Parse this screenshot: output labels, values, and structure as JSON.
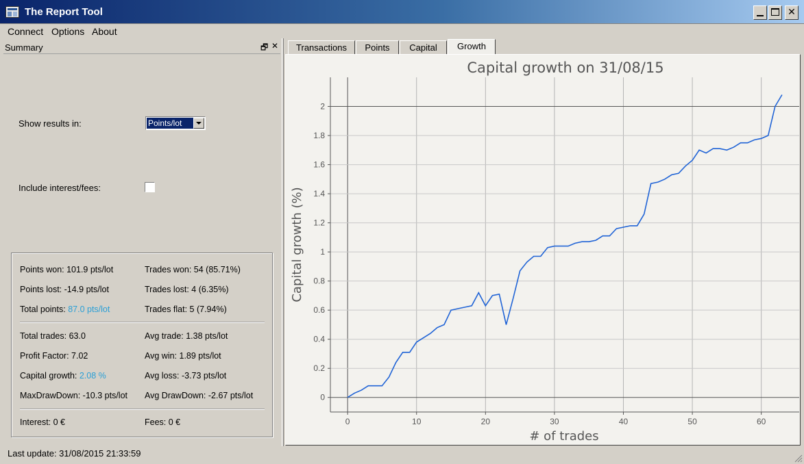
{
  "window": {
    "title": "The Report Tool"
  },
  "menu": [
    "Connect",
    "Options",
    "About"
  ],
  "summary": {
    "title": "Summary",
    "show_results_label": "Show results in:",
    "show_results_value": "Points/lot",
    "include_interest_label": "Include interest/fees:",
    "include_interest_checked": false,
    "stats": {
      "points_won": "Points won: 101.9 pts/lot",
      "trades_won": "Trades won: 54 (85.71%)",
      "points_lost": "Points lost: -14.9 pts/lot",
      "trades_lost": "Trades lost: 4 (6.35%)",
      "total_points_label": "Total points:",
      "total_points_value": "87.0 pts/lot",
      "trades_flat": "Trades flat: 5 (7.94%)",
      "total_trades": "Total trades: 63.0",
      "avg_trade": "Avg trade: 1.38 pts/lot",
      "profit_factor": "Profit Factor: 7.02",
      "avg_win": "Avg win: 1.89 pts/lot",
      "capital_growth_label": "Capital growth:",
      "capital_growth_value": "2.08 %",
      "avg_loss": "Avg loss: -3.73 pts/lot",
      "max_drawdown": "MaxDrawDown: -10.3 pts/lot",
      "avg_drawdown": "Avg DrawDown: -2.67 pts/lot",
      "interest": "Interest: 0 €",
      "fees": "Fees: 0 €"
    }
  },
  "status_bar": "Last update: 31/08/2015 21:33:59",
  "tabs": [
    {
      "label": "Transactions",
      "active": false
    },
    {
      "label": "Points",
      "active": false
    },
    {
      "label": "Capital",
      "active": false
    },
    {
      "label": "Growth",
      "active": true
    }
  ],
  "colors": {
    "line": "#1f63d6",
    "accent_value": "#2a9fd6",
    "titlebar_start": "#0a246a",
    "titlebar_end": "#a6caf0"
  },
  "chart_data": {
    "type": "line",
    "title": "Capital growth on 31/08/15",
    "xlabel": "# of trades",
    "ylabel": "Capital growth (%)",
    "xlim": [
      -2.5,
      65.5
    ],
    "ylim": [
      -0.1,
      2.2
    ],
    "xticks": [
      0,
      10,
      20,
      30,
      40,
      50,
      60
    ],
    "yticks": [
      0,
      0.2,
      0.4,
      0.6,
      0.8,
      1,
      1.2,
      1.4,
      1.6,
      1.8,
      2
    ],
    "ytick_labels": [
      "0",
      "0.2",
      "0.4",
      "0.6",
      "0.8",
      "1",
      "1.2",
      "1.4",
      "1.6",
      "1.8",
      "2"
    ],
    "grid": true,
    "series": [
      {
        "x": [
          0,
          1,
          2,
          3,
          4,
          5,
          6,
          7,
          8,
          9,
          10,
          11,
          12,
          13,
          14,
          15,
          16,
          17,
          18,
          19,
          20,
          21,
          22,
          23,
          24,
          25,
          26,
          27,
          28,
          29,
          30,
          31,
          32,
          33,
          34,
          35,
          36,
          37,
          38,
          39,
          40,
          41,
          42,
          43,
          44,
          45,
          46,
          47,
          48,
          49,
          50,
          51,
          52,
          53,
          54,
          55,
          56,
          57,
          58,
          59,
          60,
          61,
          62,
          63
        ],
        "y": [
          0,
          0.03,
          0.05,
          0.08,
          0.08,
          0.08,
          0.14,
          0.24,
          0.31,
          0.31,
          0.38,
          0.41,
          0.44,
          0.48,
          0.5,
          0.6,
          0.61,
          0.62,
          0.63,
          0.72,
          0.63,
          0.7,
          0.71,
          0.5,
          0.68,
          0.87,
          0.93,
          0.97,
          0.97,
          1.03,
          1.04,
          1.04,
          1.04,
          1.06,
          1.07,
          1.07,
          1.08,
          1.11,
          1.11,
          1.16,
          1.17,
          1.18,
          1.18,
          1.26,
          1.47,
          1.48,
          1.5,
          1.53,
          1.54,
          1.59,
          1.63,
          1.7,
          1.68,
          1.71,
          1.71,
          1.7,
          1.72,
          1.75,
          1.75,
          1.77,
          1.78,
          1.8,
          2.0,
          2.08
        ]
      }
    ]
  }
}
